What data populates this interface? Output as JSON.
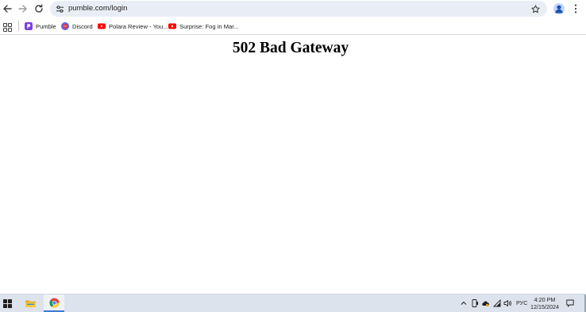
{
  "browser": {
    "url": "pumble.com/login",
    "icons": {
      "back": "arrow-left-icon",
      "forward": "arrow-right-icon",
      "reload": "reload-icon",
      "site_info": "tune-icon",
      "bookmark_star": "star-icon",
      "profile": "profile-icon",
      "menu": "kebab-menu-icon"
    }
  },
  "bookmarks": {
    "apps_icon": "apps-grid-icon",
    "items": [
      {
        "label": "Pumble",
        "icon": "pumble-icon",
        "color": "#7b3fe4"
      },
      {
        "label": "Discord",
        "icon": "discord-icon",
        "color": "#5865f2"
      },
      {
        "label": "Polara Review - You...",
        "icon": "youtube-icon",
        "color": "#ff0000"
      },
      {
        "label": "Surprise: Fog in Mar...",
        "icon": "youtube-icon",
        "color": "#ff0000"
      }
    ]
  },
  "page": {
    "heading": "502 Bad Gateway"
  },
  "taskbar": {
    "apps": [
      {
        "name": "start",
        "icon": "windows-logo-icon"
      },
      {
        "name": "file-explorer",
        "icon": "folder-icon"
      },
      {
        "name": "chrome",
        "icon": "chrome-icon",
        "active": true
      }
    ],
    "tray": {
      "icons": [
        "chevron-up-icon",
        "device-icon",
        "cloud-icon",
        "wifi-icon",
        "volume-icon",
        "notification-icon"
      ],
      "language": "РУС",
      "time": "4:20 PM",
      "date": "12/15/2024"
    }
  },
  "colors": {
    "omnibox_bg": "#e9eef6",
    "taskbar_bg": "#dde3ec",
    "accent": "#3c7bd6"
  }
}
